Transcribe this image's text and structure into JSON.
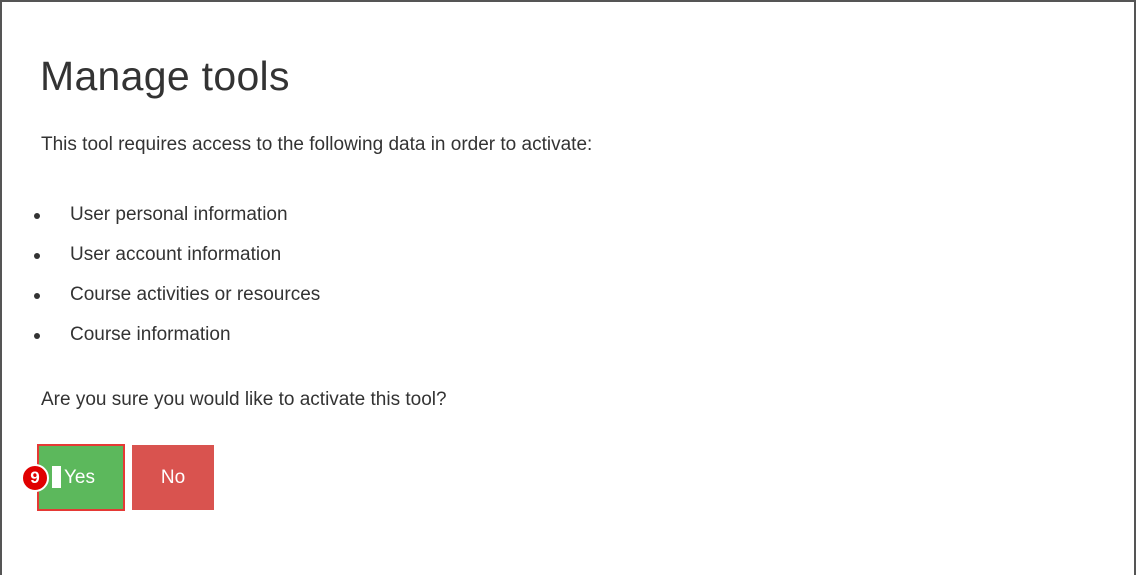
{
  "dialog": {
    "title": "Manage tools",
    "intro": "This tool requires access to the following data in order to activate:",
    "data_items": [
      "User personal information",
      "User account information",
      "Course activities or resources",
      "Course information"
    ],
    "question": "Are you sure you would like to activate this tool?",
    "yes_label": "Yes",
    "no_label": "No",
    "step_number": "9"
  },
  "colors": {
    "yes_button": "#5cb85c",
    "no_button": "#d9534f",
    "highlight_border": "#e53935",
    "step_badge": "#e00000"
  }
}
